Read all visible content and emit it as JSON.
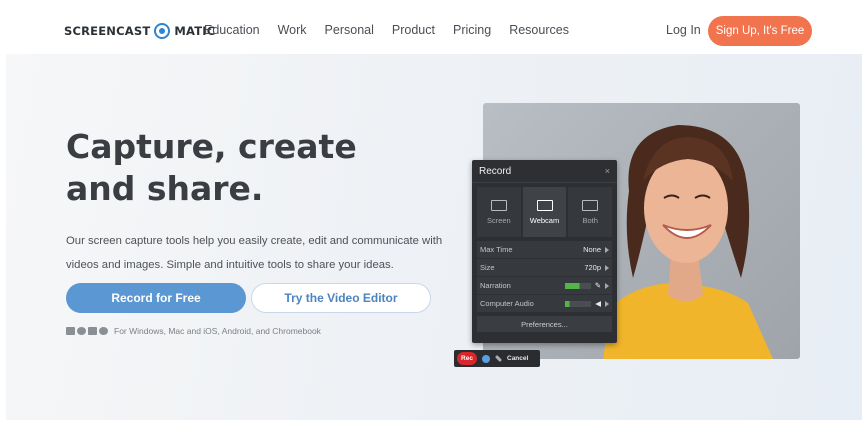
{
  "nav": {
    "logo_left": "SCREENCAST",
    "logo_right": "MATIC",
    "links": [
      "Education",
      "Work",
      "Personal",
      "Product",
      "Pricing",
      "Resources"
    ],
    "login": "Log In",
    "signup": "Sign Up, It's Free",
    "colors": {
      "signup": "#f1744f",
      "logo_accent": "#2f84cf"
    }
  },
  "hero": {
    "headline": "Capture, create and share.",
    "description": "Our screen capture tools help you easily create, edit and communicate with videos and images. Simple and intuitive tools to share your ideas.",
    "primary_button": "Record for Free",
    "secondary_button": "Try the Video Editor",
    "platforms_text": "For Windows, Mac and iOS, Android, and Chromebook",
    "platform_icons": [
      "windows-icon",
      "apple-icon",
      "android-icon",
      "chrome-icon"
    ],
    "colors": {
      "primary_button": "#5a97d3",
      "secondary_text": "#4a84c1"
    }
  },
  "record_panel": {
    "title": "Record",
    "close": "×",
    "modes": [
      {
        "label": "Screen",
        "icon": "monitor-icon",
        "active": false
      },
      {
        "label": "Webcam",
        "icon": "webcam-icon",
        "active": true
      },
      {
        "label": "Both",
        "icon": "screen-and-webcam-icon",
        "active": false
      }
    ],
    "rows": [
      {
        "label": "Max Time",
        "value": "None"
      },
      {
        "label": "Size",
        "value": "720p"
      },
      {
        "label": "Narration",
        "value": ""
      },
      {
        "label": "Computer Audio",
        "value": ""
      }
    ],
    "narration_level": 0.55,
    "computer_audio_level": 0.18,
    "preferences": "Preferences..."
  },
  "record_bar": {
    "rec": "Rec",
    "cancel": "Cancel"
  }
}
